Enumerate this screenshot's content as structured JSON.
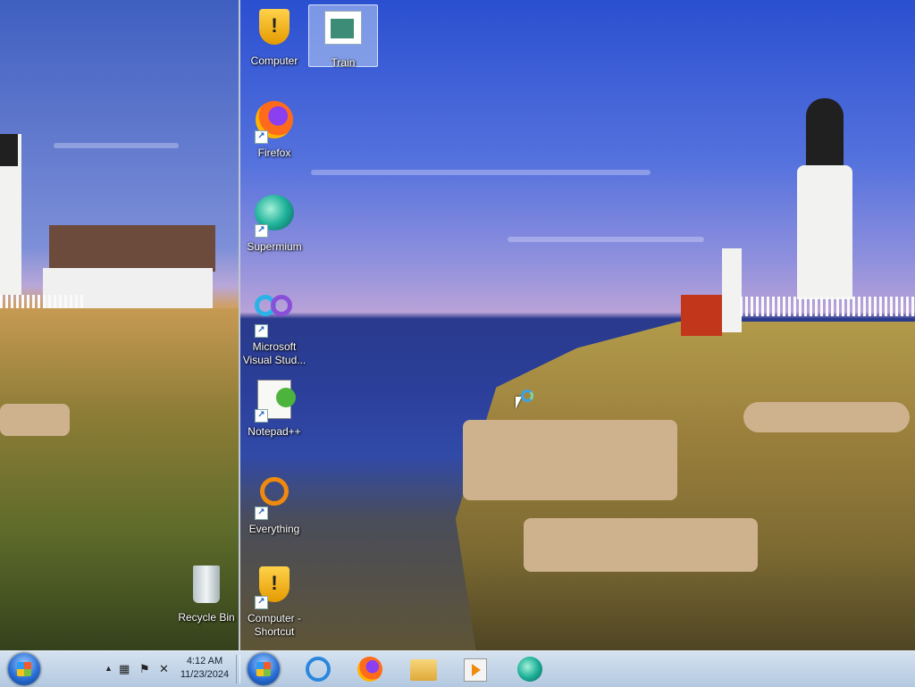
{
  "desktop": {
    "icons": [
      {
        "label": "Computer",
        "icon": "computer-shield-icon"
      },
      {
        "label": "Train",
        "icon": "train-file-icon",
        "selected": true
      },
      {
        "label": "Firefox",
        "icon": "firefox-icon",
        "shortcut": true
      },
      {
        "label": "Supermium",
        "icon": "supermium-icon",
        "shortcut": true
      },
      {
        "label": "Microsoft Visual Stud...",
        "icon": "visual-studio-icon",
        "shortcut": true
      },
      {
        "label": "Notepad++",
        "icon": "notepad-plus-plus-icon",
        "shortcut": true
      },
      {
        "label": "Everything",
        "icon": "everything-search-icon",
        "shortcut": true
      },
      {
        "label": "Recycle Bin",
        "icon": "recycle-bin-icon"
      },
      {
        "label": "Computer - Shortcut",
        "icon": "computer-shield-icon",
        "shortcut": true
      }
    ]
  },
  "taskbar": {
    "clock": {
      "time": "4:12 AM",
      "date": "11/23/2024"
    },
    "tray": [
      "show-hidden-icons-arrow",
      "network-icon",
      "action-center-flag-icon",
      "volume-muted-icon"
    ],
    "pinned": [
      "internet-explorer-icon",
      "firefox-icon",
      "file-explorer-icon",
      "media-player-icon",
      "supermium-icon"
    ]
  },
  "colors": {
    "taskbar": "#c4d5e8",
    "selection": "#bed2f5",
    "label_text": "#ffffff"
  }
}
